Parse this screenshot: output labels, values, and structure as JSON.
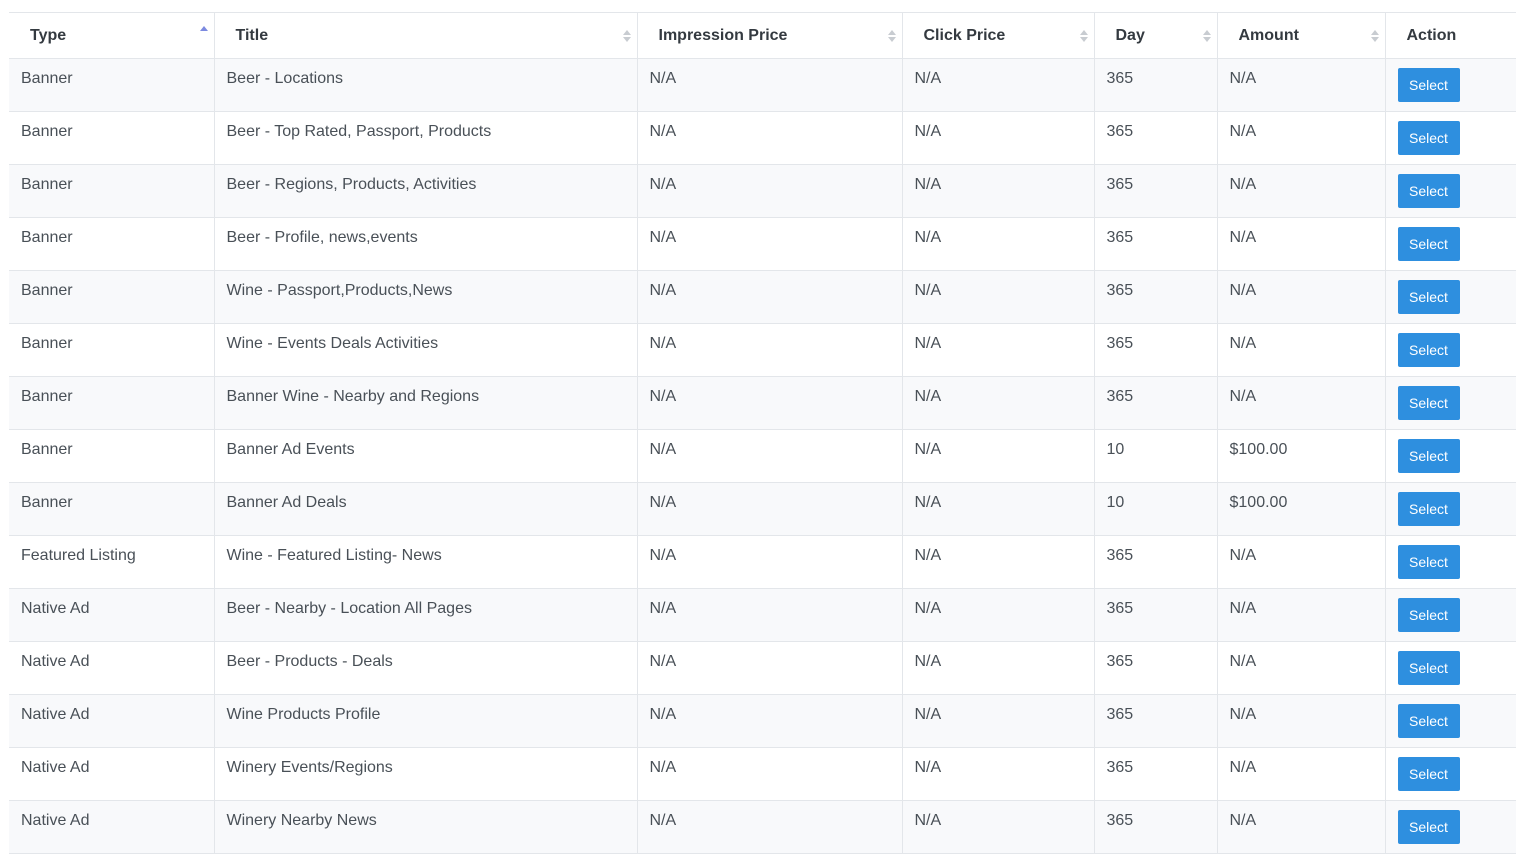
{
  "table": {
    "columns": [
      {
        "label": "Type",
        "sortable": true,
        "sort": "asc"
      },
      {
        "label": "Title",
        "sortable": true,
        "sort": "none"
      },
      {
        "label": "Impression Price",
        "sortable": true,
        "sort": "none"
      },
      {
        "label": "Click Price",
        "sortable": true,
        "sort": "none"
      },
      {
        "label": "Day",
        "sortable": true,
        "sort": "none"
      },
      {
        "label": "Amount",
        "sortable": true,
        "sort": "none"
      },
      {
        "label": "Action",
        "sortable": false,
        "sort": "none"
      }
    ],
    "action_label": "Select",
    "rows": [
      {
        "type": "Banner",
        "title": "Beer - Locations",
        "impression_price": "N/A",
        "click_price": "N/A",
        "day": "365",
        "amount": "N/A"
      },
      {
        "type": "Banner",
        "title": "Beer - Top Rated, Passport, Products",
        "impression_price": "N/A",
        "click_price": "N/A",
        "day": "365",
        "amount": "N/A"
      },
      {
        "type": "Banner",
        "title": "Beer - Regions, Products, Activities",
        "impression_price": "N/A",
        "click_price": "N/A",
        "day": "365",
        "amount": "N/A"
      },
      {
        "type": "Banner",
        "title": "Beer - Profile, news,events",
        "impression_price": "N/A",
        "click_price": "N/A",
        "day": "365",
        "amount": "N/A"
      },
      {
        "type": "Banner",
        "title": "Wine - Passport,Products,News",
        "impression_price": "N/A",
        "click_price": "N/A",
        "day": "365",
        "amount": "N/A"
      },
      {
        "type": "Banner",
        "title": "Wine - Events Deals Activities",
        "impression_price": "N/A",
        "click_price": "N/A",
        "day": "365",
        "amount": "N/A"
      },
      {
        "type": "Banner",
        "title": "Banner Wine - Nearby and Regions",
        "impression_price": "N/A",
        "click_price": "N/A",
        "day": "365",
        "amount": "N/A"
      },
      {
        "type": "Banner",
        "title": "Banner Ad Events",
        "impression_price": "N/A",
        "click_price": "N/A",
        "day": "10",
        "amount": "$100.00"
      },
      {
        "type": "Banner",
        "title": "Banner Ad Deals",
        "impression_price": "N/A",
        "click_price": "N/A",
        "day": "10",
        "amount": "$100.00"
      },
      {
        "type": "Featured Listing",
        "title": "Wine - Featured Listing- News",
        "impression_price": "N/A",
        "click_price": "N/A",
        "day": "365",
        "amount": "N/A"
      },
      {
        "type": "Native Ad",
        "title": "Beer - Nearby - Location All Pages",
        "impression_price": "N/A",
        "click_price": "N/A",
        "day": "365",
        "amount": "N/A"
      },
      {
        "type": "Native Ad",
        "title": "Beer - Products - Deals",
        "impression_price": "N/A",
        "click_price": "N/A",
        "day": "365",
        "amount": "N/A"
      },
      {
        "type": "Native Ad",
        "title": "Wine Products Profile",
        "impression_price": "N/A",
        "click_price": "N/A",
        "day": "365",
        "amount": "N/A"
      },
      {
        "type": "Native Ad",
        "title": "Winery Events/Regions",
        "impression_price": "N/A",
        "click_price": "N/A",
        "day": "365",
        "amount": "N/A"
      },
      {
        "type": "Native Ad",
        "title": "Winery Nearby News",
        "impression_price": "N/A",
        "click_price": "N/A",
        "day": "365",
        "amount": "N/A"
      }
    ]
  },
  "colors": {
    "button_bg": "#2e8fdf",
    "sort_active": "#7c8ae0",
    "row_stripe": "#f8f9fb",
    "border": "#e3e6ea"
  },
  "icons": {
    "sort_asc": "sort-asc-icon",
    "sort_both": "sort-both-icon"
  }
}
